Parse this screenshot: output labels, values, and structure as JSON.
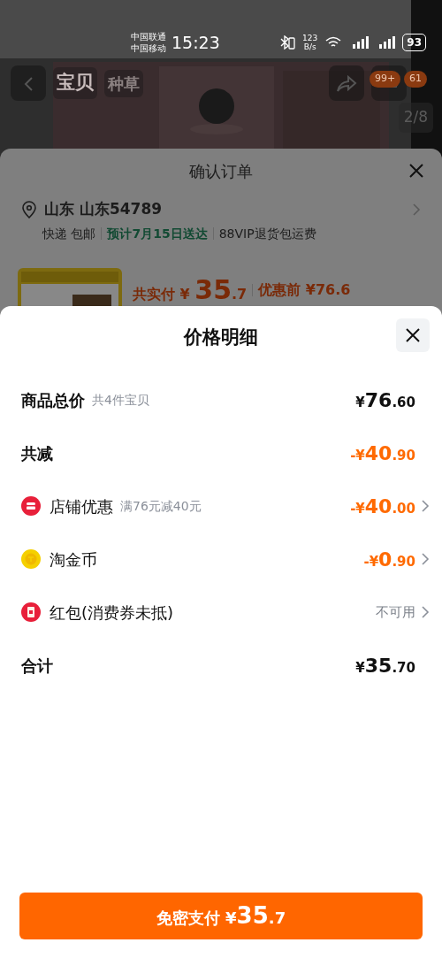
{
  "status_bar": {
    "carriers": [
      "中国联通",
      "中国移动"
    ],
    "time": "15:23",
    "net_speed": [
      "123",
      "B/s"
    ],
    "battery": "93"
  },
  "product_page": {
    "tabs": [
      {
        "label": "宝贝",
        "selected": true
      },
      {
        "label": "种草",
        "selected": false
      }
    ],
    "cart_badge": "99+",
    "message_badge": "61",
    "image_counter": "2/8"
  },
  "order_sheet": {
    "title": "确认订单",
    "address": "山东 山东54789",
    "shipping": "快递 包邮",
    "delivery": "预计7月15日送达",
    "service": "88VIP退货包运费",
    "paid_label": "共实付",
    "paid_amount": "¥ 35.7",
    "original_label": "优惠前 ¥76.6"
  },
  "price_sheet": {
    "title": "价格明细",
    "rows": [
      {
        "kind": "total",
        "label": "商品总价",
        "note": "共4件宝贝",
        "amount": "¥76.60",
        "highlighted": false
      },
      {
        "kind": "total",
        "label": "共减",
        "amount": "-¥40.90",
        "highlighted": true
      },
      {
        "kind": "shop",
        "label": "店铺优惠",
        "note": "满76元减40元",
        "amount": "-¥40.00",
        "highlighted": true
      },
      {
        "kind": "coin",
        "label": "淘金币",
        "amount": "-¥0.90",
        "highlighted": true
      },
      {
        "kind": "packet",
        "label": "红包(消费券未抵)",
        "amount": "不可用",
        "highlighted": false
      },
      {
        "kind": "total",
        "label": "合计",
        "amount": "¥35.70",
        "highlighted": false
      }
    ]
  },
  "pay_button": {
    "label": "免密支付",
    "amount": "¥35.7"
  }
}
